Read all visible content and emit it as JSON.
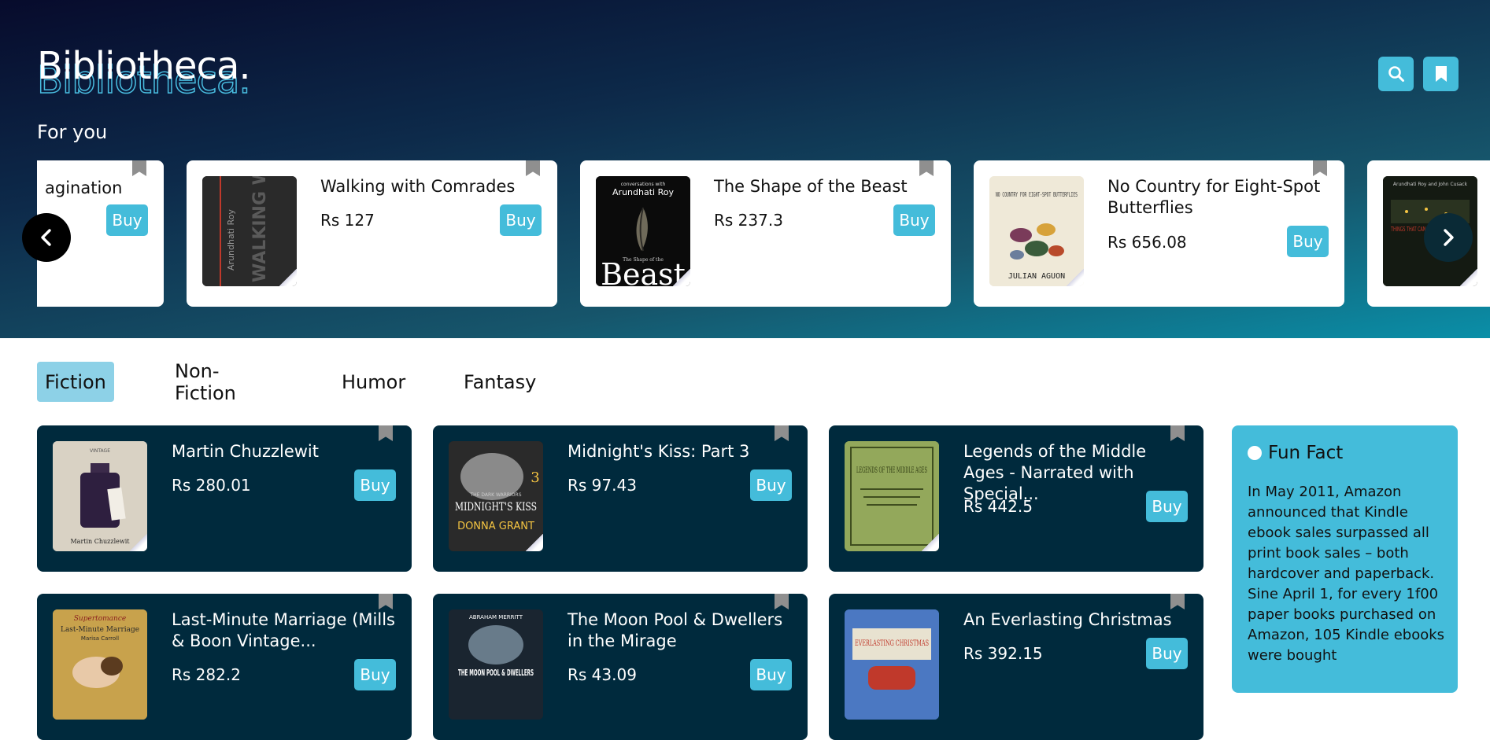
{
  "app": {
    "logo": "Bibliotheca."
  },
  "header": {
    "search_icon": "search-icon",
    "bookmarks_icon": "bookmark-icon"
  },
  "for_you": {
    "heading": "For you",
    "items": [
      {
        "title": "agination",
        "price": "",
        "buy": "Buy"
      },
      {
        "title": "Walking with Comrades",
        "price": "Rs 127",
        "buy": "Buy"
      },
      {
        "title": "The Shape of the Beast",
        "price": "Rs 237.3",
        "buy": "Buy"
      },
      {
        "title": "No Country for Eight-Spot Butterflies",
        "price": "Rs 656.08",
        "buy": "Buy"
      }
    ]
  },
  "tabs": [
    "Fiction",
    "Non-Fiction",
    "Humor",
    "Fantasy"
  ],
  "books": [
    {
      "title": "Martin Chuzzlewit",
      "price": "Rs 280.01",
      "buy": "Buy"
    },
    {
      "title": "Midnight's Kiss: Part 3",
      "price": "Rs 97.43",
      "buy": "Buy"
    },
    {
      "title": "Legends of the Middle Ages - Narrated with Special...",
      "price": "Rs 442.5",
      "buy": "Buy"
    },
    {
      "title": "Last-Minute Marriage (Mills & Boon Vintage...",
      "price": "Rs 282.2",
      "buy": "Buy"
    },
    {
      "title": "The Moon Pool & Dwellers in the Mirage",
      "price": "Rs 43.09",
      "buy": "Buy"
    },
    {
      "title": "An Everlasting Christmas",
      "price": "Rs 392.15",
      "buy": "Buy"
    }
  ],
  "cover_text": {
    "walking_author": "Arundhati Roy",
    "walking_title": "WALKING WITH COMRADES",
    "beast_top": "conversations with",
    "beast_author": "Arundhati Roy",
    "beast_small": "The Shape of the",
    "beast_big": "Beast",
    "butterflies_title": "NO COUNTRY FOR EIGHT-SPOT BUTTERFLIES",
    "butterflies_author": "JULIAN AGUON",
    "fifth_author": "Arundhati Roy and John Cusack",
    "fifth_title": "THINGS THAT CAN AND CANNOT BE SAID",
    "martin_top": "VINTAGE",
    "martin_title": "Martin Chuzzlewit",
    "midnight_series": "THE DARK WARRIORS",
    "midnight_title": "MIDNIGHT'S KISS",
    "midnight_author": "DONNA GRANT",
    "midnight_num": "3",
    "legends_title": "LEGENDS OF THE MIDDLE AGES",
    "marriage_series": "Supertomance",
    "marriage_title": "Last-Minute Marriage",
    "marriage_author": "Marisa Carroll",
    "moon_author": "ABRAHAM MERRITT",
    "moon_title": "THE MOON POOL & DWELLERS",
    "xmas_title": "EVERLASTING CHRISTMAS"
  },
  "fun_fact": {
    "title": "Fun Fact",
    "body": "In May 2011, Amazon announced that Kindle ebook sales surpassed all print book sales – both hardcover and paperback. Sine April 1, for every 1f00 paper books purchased on Amazon, 105 Kindle ebooks were bought"
  },
  "colors": {
    "accent": "#44bcda",
    "dark_card": "#002a3d",
    "active_tab": "#8dd1e7",
    "bookmark": "#8f8f8f"
  }
}
